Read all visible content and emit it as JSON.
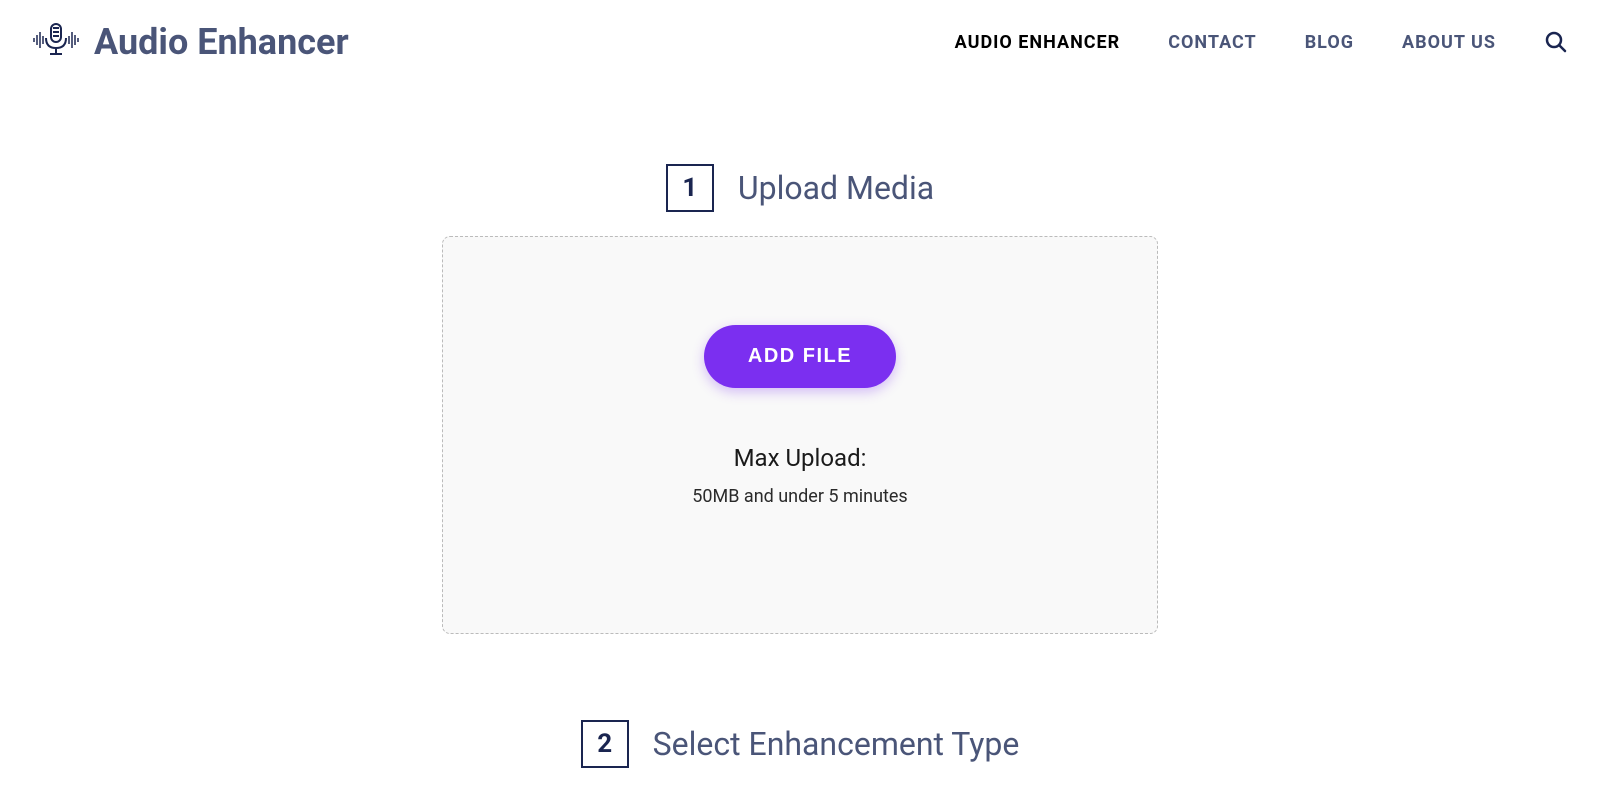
{
  "header": {
    "brand": "Audio Enhancer",
    "nav": [
      {
        "label": "AUDIO ENHANCER",
        "active": true
      },
      {
        "label": "CONTACT",
        "active": false
      },
      {
        "label": "BLOG",
        "active": false
      },
      {
        "label": "ABOUT US",
        "active": false
      }
    ]
  },
  "steps": {
    "step1": {
      "number": "1",
      "title": "Upload Media",
      "button": "ADD FILE",
      "max_label": "Max Upload:",
      "max_detail": "50MB and under 5 minutes"
    },
    "step2": {
      "number": "2",
      "title": "Select Enhancement Type"
    }
  },
  "colors": {
    "accent": "#7b2ff0",
    "text_muted": "#4a5578",
    "text_dark": "#1a2550"
  }
}
